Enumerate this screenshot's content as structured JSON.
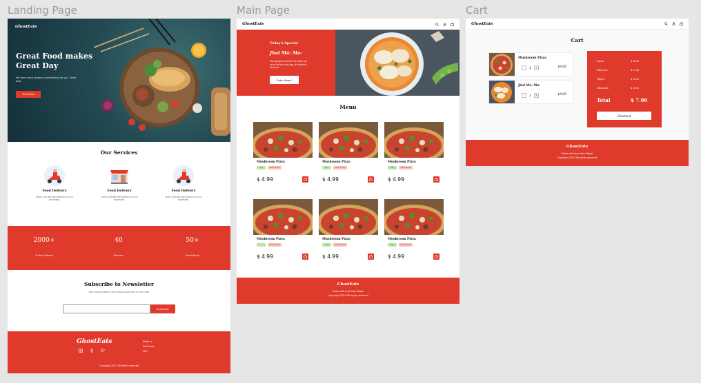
{
  "frames": {
    "landing_label": "Landing Page",
    "main_label": "Main Page",
    "cart_label": "Cart"
  },
  "brand": {
    "logo": "GhostEats"
  },
  "colors": {
    "accent": "#e03a2c",
    "tag_veg_bg": "#b9e7a6",
    "tag_kcal_bg": "#f6c4bd"
  },
  "landing": {
    "hero": {
      "title": "Great Food makes Great Day",
      "subtitle": "We have some amazing food waiting for you. Order Now.",
      "cta": "Find Food"
    },
    "services": {
      "title": "Our Services",
      "items": [
        {
          "title": "Food Delivery",
          "desc": "Quick and fast food delivery at our doorsteps.",
          "icon": "scooter-delivery-icon"
        },
        {
          "title": "Food Delivery",
          "desc": "Quick and fast food delivery at our doorsteps.",
          "icon": "store-icon"
        },
        {
          "title": "Food Delivery",
          "desc": "Quick and fast food delivery at our doorsteps.",
          "icon": "scooter-delivery-icon"
        }
      ]
    },
    "stats": [
      {
        "value": "2000+",
        "label": "Orders Placed"
      },
      {
        "value": "40",
        "label": "Partners"
      },
      {
        "value": "50+",
        "label": "Food Items"
      }
    ],
    "newsletter": {
      "title": "Subscribe to Newsletter",
      "subtitle": "Get amazing offers and coupons directly in your mail",
      "input_placeholder": "",
      "button": "Subscribe"
    },
    "footer": {
      "links": [
        "Made to",
        "Find Food",
        "FAQ"
      ],
      "social_icons": [
        "instagram-icon",
        "facebook-icon",
        "twitter-icon"
      ],
      "copyright": "Copyright 2022 All rights reserved"
    }
  },
  "main": {
    "special": {
      "heading": "Today's Special",
      "dish": "Jhol Mo: Mo:",
      "desc": "The goodness of Mo: Mo: with hot soup for this cold day. Its nature's demand.",
      "cta": "Order Now !"
    },
    "menu_title": "Menu",
    "items": [
      {
        "name": "Mushroom Pizza",
        "tag1": "Veg",
        "tag2": "Most Loved",
        "price": "$ 4.99"
      },
      {
        "name": "Mushroom Pizza",
        "tag1": "Veg",
        "tag2": "Most Loved",
        "price": "$ 4.99"
      },
      {
        "name": "Mushroom Pizza",
        "tag1": "Veg",
        "tag2": "Most Loved",
        "price": "$ 4.99"
      },
      {
        "name": "Mushroom Pizza",
        "tag1": "",
        "tag2": "Most Loved",
        "price": "$ 4.99"
      },
      {
        "name": "Mushroom Pizza",
        "tag1": "Veg",
        "tag2": "Most Loved",
        "price": "$ 4.99"
      },
      {
        "name": "Mushroom Pizza",
        "tag1": "Veg",
        "tag2": "Most Loved",
        "price": "$ 4.99"
      }
    ],
    "footer": {
      "line1": "Made with love from Nepal",
      "copyright": "Copyright 2022 All rights reserved"
    }
  },
  "cart": {
    "title": "Cart",
    "items": [
      {
        "name": "Mushroom Pizza",
        "qty": "2",
        "price": "$6.00"
      },
      {
        "name": "Jhol Mo: Mo:",
        "qty": "2",
        "price": "$4.00"
      }
    ],
    "summary": {
      "food_label": "Food:",
      "food": "$ 8.00",
      "delivery_label": "Delivery:",
      "delivery": "$ 1.00",
      "taxes_label": "Taxes:",
      "taxes": "$ 0.50",
      "discount_label": "Discount:",
      "discount": "$ 0.50",
      "total_label": "Total",
      "total": "$ 7.00",
      "checkout": "Checkout"
    },
    "footer": {
      "line1": "Made with love from Nepal",
      "copyright": "Copyright 2022 All rights reserved"
    }
  }
}
